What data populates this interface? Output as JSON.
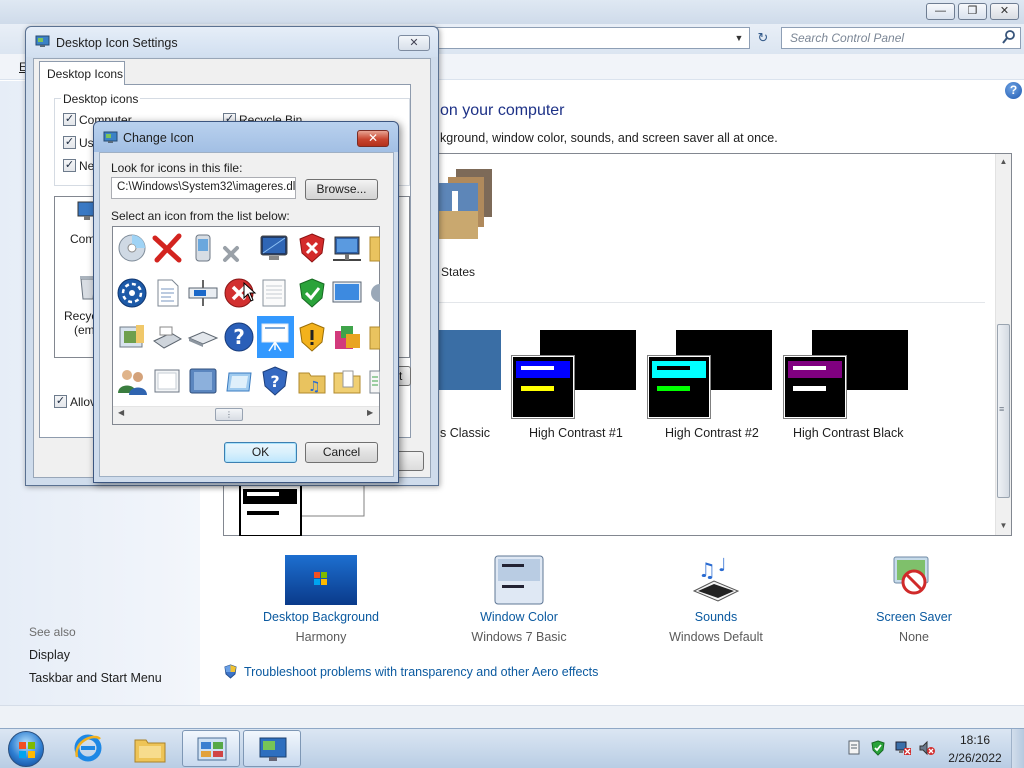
{
  "control_panel": {
    "search_placeholder": "Search Control Panel",
    "menu_letter": "E",
    "heading": "on your computer",
    "subheading": "kground, window color, sounds, and screen saver all at once.",
    "themes": [
      {
        "name": "States",
        "label": "States"
      },
      {
        "name": "Classic",
        "label": "s Classic",
        "color": "#3a6ea5"
      },
      {
        "name": "High Contrast #1",
        "label": "High Contrast #1",
        "bar_color": "#0000ff",
        "accent_color": "#ffff00"
      },
      {
        "name": "High Contrast #2",
        "label": "High Contrast #2",
        "bar_color": "#00ffff",
        "accent_color": "#00ff00"
      },
      {
        "name": "High Contrast Black",
        "label": "High Contrast Black",
        "bar_color": "#800080",
        "accent_color": "#ffffff"
      }
    ],
    "bottom_items": [
      {
        "title": "Desktop Background",
        "subtitle": "Harmony",
        "icon": "desktop-background-icon"
      },
      {
        "title": "Window Color",
        "subtitle": "Windows 7 Basic",
        "icon": "window-color-icon"
      },
      {
        "title": "Sounds",
        "subtitle": "Windows Default",
        "icon": "sounds-icon"
      },
      {
        "title": "Screen Saver",
        "subtitle": "None",
        "icon": "screen-saver-icon"
      }
    ],
    "see_also": {
      "heading": "See also",
      "links": [
        "Display",
        "Taskbar and Start Menu"
      ]
    },
    "troubleshoot_link": "Troubleshoot problems with transparency and other Aero effects"
  },
  "desktop_icon_settings": {
    "title": "Desktop Icon Settings",
    "tab": "Desktop Icons",
    "group_label": "Desktop icons",
    "checkboxes": [
      {
        "label": "Computer",
        "checked": true
      },
      {
        "label": "Recycle Bin",
        "checked": true
      },
      {
        "label": "Use",
        "checked": true
      },
      {
        "label": "Ne",
        "checked": true
      }
    ],
    "icon_fragments": {
      "computer": "Comp",
      "recycle": "Recyc",
      "empty": "(em"
    },
    "allow_label": "Allov",
    "allow_checked": true,
    "truncated_button": "t"
  },
  "change_icon": {
    "title": "Change Icon",
    "look_label": "Look for icons in this file:",
    "path": "C:\\Windows\\System32\\imageres.dll",
    "browse_label": "Browse...",
    "select_label": "Select an icon from the list below:",
    "selected_icon": "presentation-screen-icon",
    "ok_label": "OK",
    "cancel_label": "Cancel"
  },
  "taskbar": {
    "items": [
      "start-orb",
      "internet-explorer-icon",
      "file-explorer-icon",
      "control-panel-icon",
      "desktop-icon-settings-icon"
    ],
    "time": "18:16",
    "date": "2/26/2022"
  }
}
